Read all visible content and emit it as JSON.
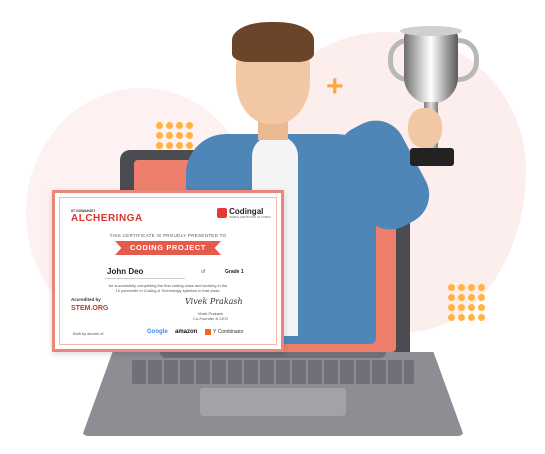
{
  "certificate": {
    "org_left_tagline": "IIT GUWAHATI",
    "org_left_name": "ALCHERINGA",
    "org_right_name": "Codingal",
    "org_right_tagline": "SAMPLE CERTIFICATE OF CODING",
    "presented_to_label": "THIS CERTIFICATE IS PROUDLY PRESENTED TO",
    "title": "CODING PROJECT",
    "recipient_name": "John Deo",
    "of_label": "of",
    "grade": "Grade 1",
    "description_line1": "for successfully completing the first coding class and working in the",
    "description_line2": "10 percentile in Coding & Technology syllabus in that class.",
    "accredited_by_label": "Accredited by",
    "accreditor_name": "STEM.ORG",
    "signature": "Vivek Prakash",
    "signatory_name": "Vivek Prakash",
    "signatory_title": "Co-Founder & CEO",
    "built_by_label": "Built by alumni of",
    "partners": [
      "Google",
      "amazon",
      "Y Combinator"
    ]
  },
  "colors": {
    "accent": "#e45a4b",
    "laptop_screen": "#ee7f6c",
    "dots": "#ffb347"
  }
}
